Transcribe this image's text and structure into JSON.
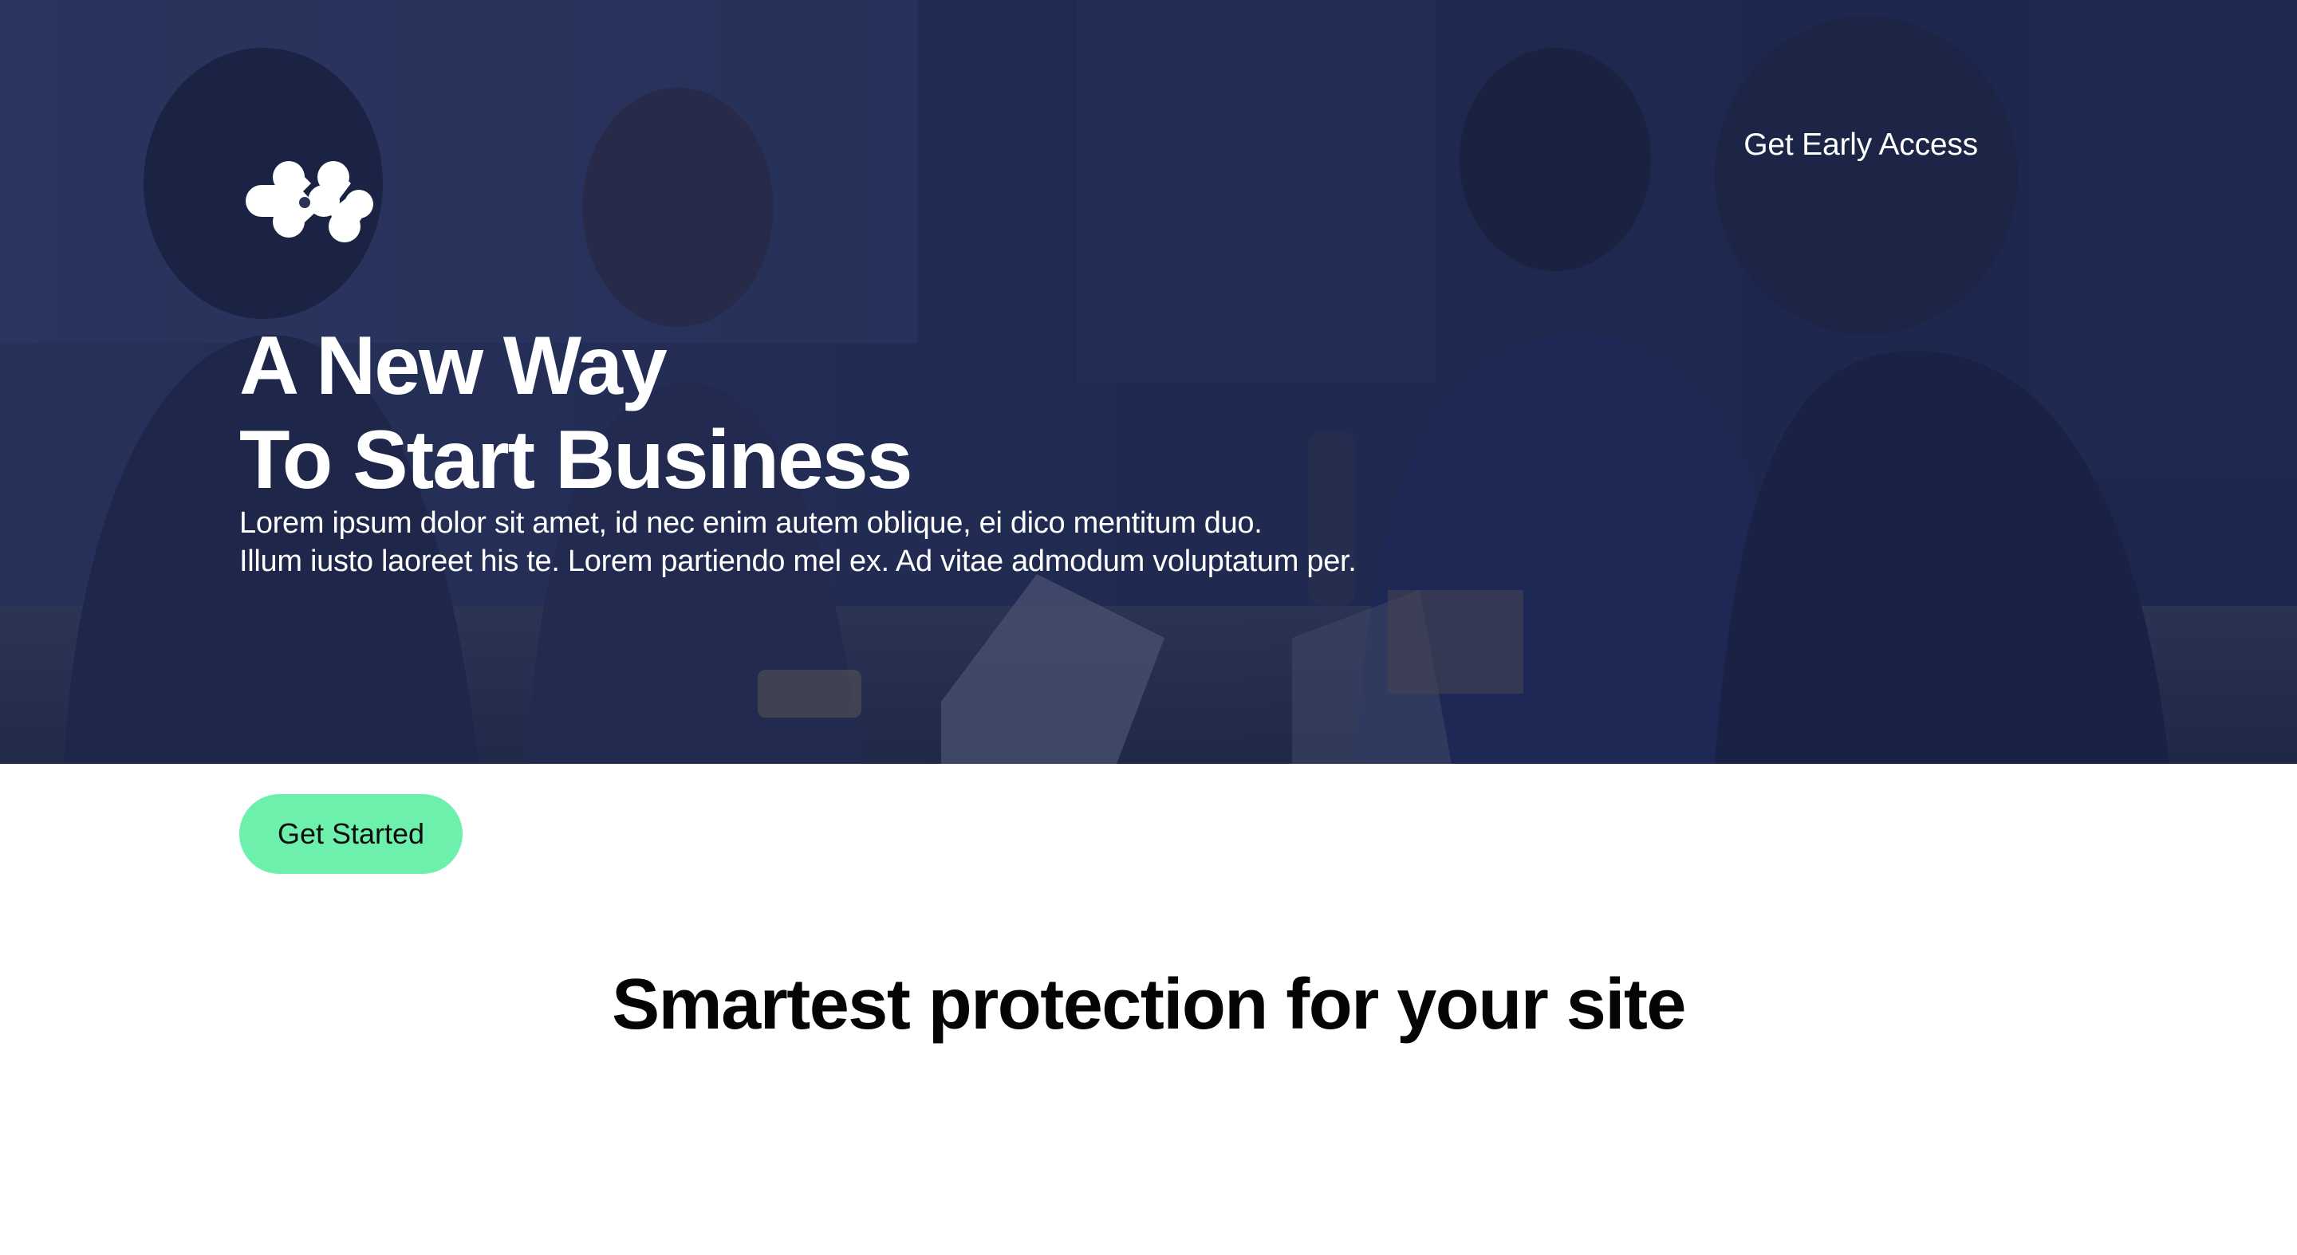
{
  "nav": {
    "early_access_label": "Get Early Access"
  },
  "hero": {
    "logo_icon": "brand-logo-icon",
    "title_line1": "A New Way",
    "title_line2": "To Start Business",
    "subtitle_line1": "Lorem ipsum dolor sit amet, id nec enim autem oblique, ei dico mentitum duo.",
    "subtitle_line2": "Illum iusto laoreet his te. Lorem partiendo mel ex. Ad vitae admodum voluptatum per.",
    "overlay_color": "#18224e",
    "photo_alt": "team working at laptops"
  },
  "cta": {
    "label": "Get Started",
    "color": "#6ef0ad"
  },
  "section": {
    "title": "Smartest protection for your site"
  }
}
